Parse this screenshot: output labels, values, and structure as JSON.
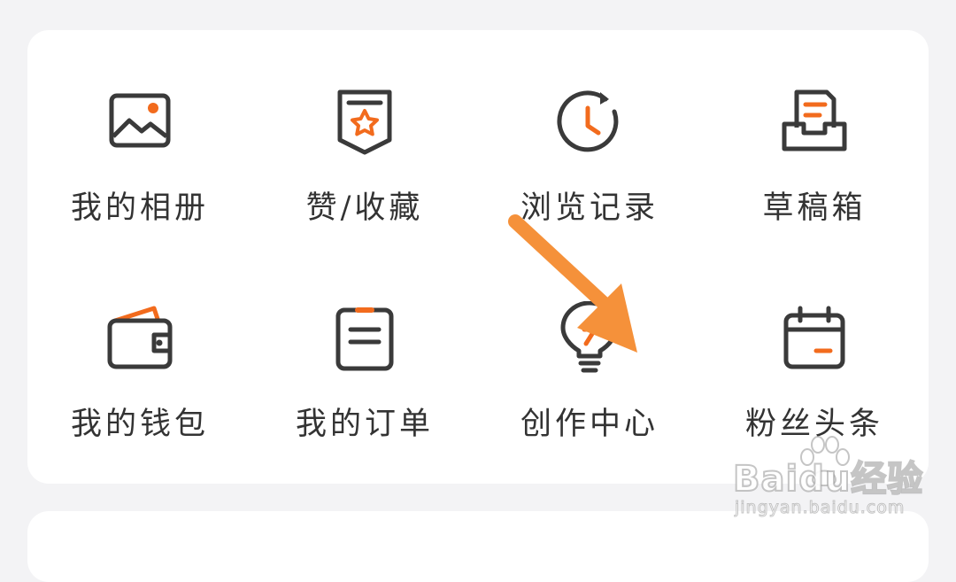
{
  "menu": {
    "items": [
      {
        "label": "我的相册",
        "icon": "photo-album-icon"
      },
      {
        "label": "赞/收藏",
        "icon": "favorite-star-icon"
      },
      {
        "label": "浏览记录",
        "icon": "history-clock-icon"
      },
      {
        "label": "草稿箱",
        "icon": "drafts-tray-icon"
      },
      {
        "label": "我的钱包",
        "icon": "wallet-icon"
      },
      {
        "label": "我的订单",
        "icon": "orders-clipboard-icon"
      },
      {
        "label": "创作中心",
        "icon": "creation-lightbulb-icon"
      },
      {
        "label": "粉丝头条",
        "icon": "calendar-icon"
      }
    ]
  },
  "colors": {
    "accent": "#f26b1d",
    "icon_stroke": "#3a3a3a",
    "label": "#333333",
    "card": "#ffffff",
    "background": "#f3f3f5",
    "annotation_arrow": "#f5913a"
  },
  "watermark": {
    "logo": "Baidu经验",
    "url": "jingyan.baidu.com"
  }
}
